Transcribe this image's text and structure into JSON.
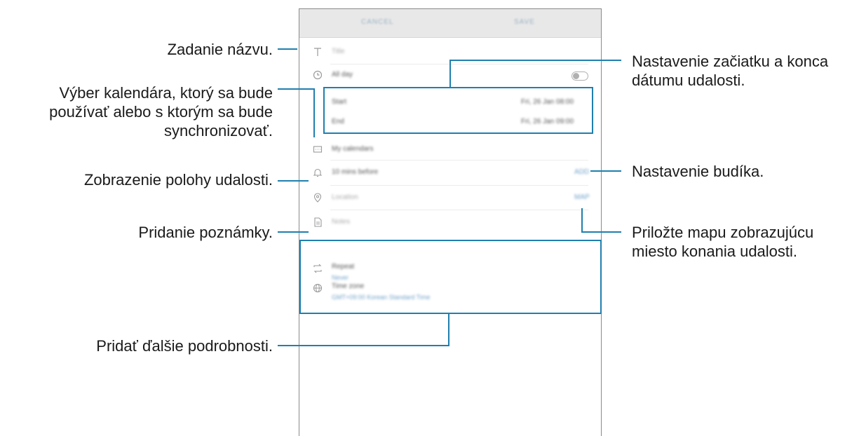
{
  "screen": {
    "cancel_label": "CANCEL",
    "save_label": "SAVE",
    "title_placeholder": "Title",
    "allday_label": "All day",
    "start_label": "Start",
    "start_value": "Fri, 26 Jan  08:00",
    "end_label": "End",
    "end_value": "Fri, 26 Jan  09:00",
    "calendar_label": "My calendars",
    "reminder_label": "10 mins before",
    "reminder_add": "ADD",
    "location_placeholder": "Location",
    "map_label": "MAP",
    "notes_placeholder": "Notes",
    "repeat_label": "Repeat",
    "repeat_value": "Never",
    "timezone_label": "Time zone",
    "timezone_value": "GMT+09:00 Korean Standard Time"
  },
  "callouts": {
    "title": "Zadanie názvu.",
    "calendar": [
      "Výber kalendára, ktorý sa bude",
      "používať alebo s ktorým sa bude",
      "synchronizovať."
    ],
    "location": "Zobrazenie polohy udalosti.",
    "note": "Pridanie poznámky.",
    "details": "Pridať ďalšie podrobnosti.",
    "dates": [
      "Nastavenie začiatku a konca",
      "dátumu udalosti."
    ],
    "alarm": "Nastavenie budíka.",
    "map": [
      "Priložte mapu zobrazujúcu",
      "miesto konania udalosti."
    ]
  },
  "colors": {
    "accent": "#1f7fae",
    "frame": "#8a8a8a"
  }
}
